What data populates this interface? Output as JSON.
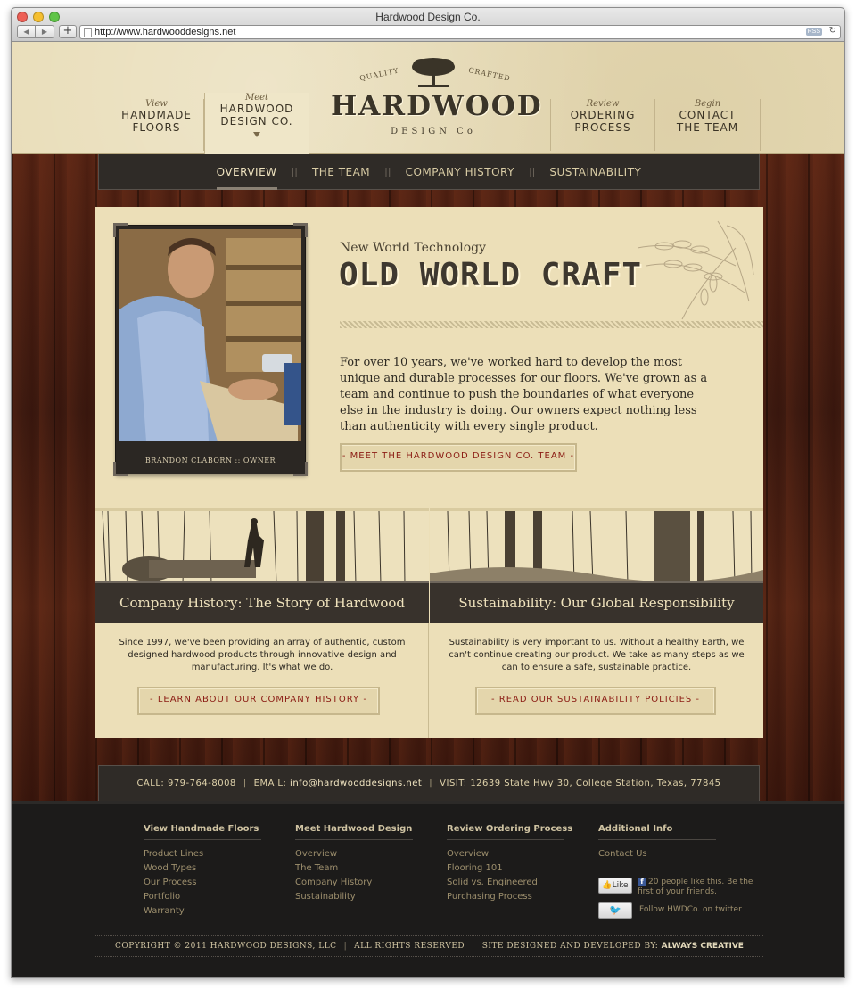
{
  "browser": {
    "window_title": "Hardwood Design Co.",
    "url": "http://www.hardwooddesigns.net",
    "rss_label": "RSS",
    "reload_icon": "reload-icon"
  },
  "header": {
    "nav": [
      {
        "small": "View",
        "big_line1": "HANDMADE",
        "big_line2": "FLOORS"
      },
      {
        "small": "Meet",
        "big_line1": "HARDWOOD",
        "big_line2": "DESIGN CO."
      },
      {
        "small": "Review",
        "big_line1": "ORDERING",
        "big_line2": "PROCESS"
      },
      {
        "small": "Begin",
        "big_line1": "CONTACT",
        "big_line2": "THE TEAM"
      }
    ],
    "logo": {
      "quality": "QUALITY",
      "crafted": "CRAFTED",
      "brand": "HARDWOOD",
      "sub": "DESIGN Co"
    }
  },
  "subnav": {
    "items": [
      "OVERVIEW",
      "THE TEAM",
      "COMPANY HISTORY",
      "SUSTAINABILITY"
    ],
    "separator": "||",
    "active": "OVERVIEW"
  },
  "hero": {
    "photo_caption": "BRANDON CLABORN :: OWNER",
    "kicker": "New World Technology",
    "headline": "OLD WORLD CRAFT",
    "body": "For over 10 years, we've worked hard to develop the most unique and durable processes for our floors. We've grown as a team and continue to push the boundaries of what everyone else in the industry is doing. Our owners expect nothing less than authenticity with every single product.",
    "button": "- MEET THE HARDWOOD DESIGN CO. TEAM -"
  },
  "columns": [
    {
      "title": "Company History: The Story of Hardwood",
      "text": "Since 1997, we've been providing an array of authentic, custom designed hardwood products through innovative design and manufacturing. It's what we do.",
      "button": "- LEARN ABOUT OUR COMPANY HISTORY -"
    },
    {
      "title": "Sustainability: Our Global Responsibility",
      "text": "Sustainability is very important to us. Without a healthy Earth, we can't continue creating our product. We take as many steps as we can to ensure a safe, sustainable practice.",
      "button": "- READ OUR SUSTAINABILITY POLICIES -"
    }
  ],
  "contact": {
    "call": "CALL: 979-764-8008",
    "email_label": "EMAIL:",
    "email": "info@hardwooddesigns.net",
    "visit": "VISIT: 12639 State Hwy 30, College Station, Texas, 77845",
    "separator": "|"
  },
  "footer": {
    "columns": [
      {
        "heading": "View Handmade Floors",
        "links": [
          "Product Lines",
          "Wood Types",
          "Our Process",
          "Portfolio",
          "Warranty"
        ]
      },
      {
        "heading": "Meet Hardwood Design",
        "links": [
          "Overview",
          "The Team",
          "Company History",
          "Sustainability"
        ]
      },
      {
        "heading": "Review Ordering Process",
        "links": [
          "Overview",
          "Flooring 101",
          "Solid vs. Engineered",
          "Purchasing Process"
        ]
      },
      {
        "heading": "Additional Info",
        "links": [
          "Contact Us"
        ]
      }
    ],
    "like_button": "Like",
    "like_text": "20 people like this. Be the first of your friends.",
    "twitter_text": "Follow HWDCo. on twitter",
    "copyright": "COPYRIGHT © 2011 HARDWOOD DESIGNS, LLC",
    "rights": "ALL RIGHTS RESERVED",
    "designed_by": "SITE DESIGNED AND DEVELOPED BY:",
    "designer": "ALWAYS CREATIVE",
    "separator": "|"
  },
  "colors": {
    "parchment": "#e8dcb6",
    "panel": "#ecdfb8",
    "dark_bar": "#2f2b27",
    "accent_red": "#8b1c14",
    "footer_bg": "#1c1b1a"
  }
}
